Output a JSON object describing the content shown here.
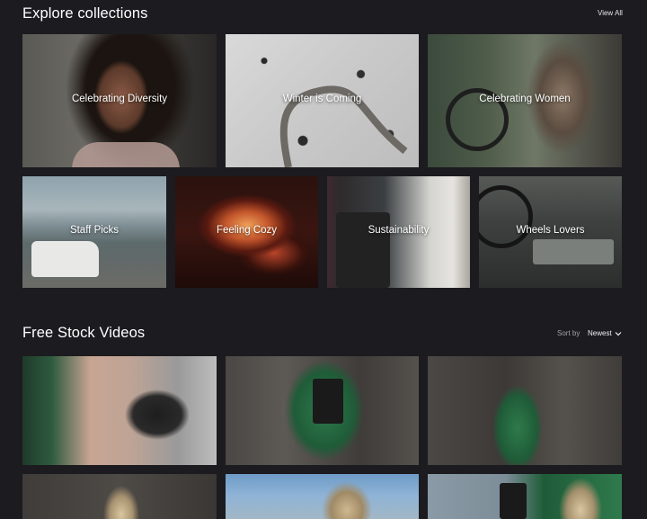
{
  "collections": {
    "title": "Explore collections",
    "view_all": "View All",
    "row1": [
      {
        "label": "Celebrating Diversity"
      },
      {
        "label": "Winter is Coming"
      },
      {
        "label": "Celebrating Women"
      }
    ],
    "row2": [
      {
        "label": "Staff Picks"
      },
      {
        "label": "Feeling Cozy"
      },
      {
        "label": "Sustainability"
      },
      {
        "label": "Wheels Lovers"
      }
    ]
  },
  "videos": {
    "title": "Free Stock Videos",
    "sort_label": "Sort by",
    "sort_value": "Newest"
  },
  "colors": {
    "background": "#1c1b1f",
    "text": "#ffffff",
    "muted": "#a4a4a8"
  },
  "icons": {
    "sort_chevron": "chevron-down-icon"
  }
}
